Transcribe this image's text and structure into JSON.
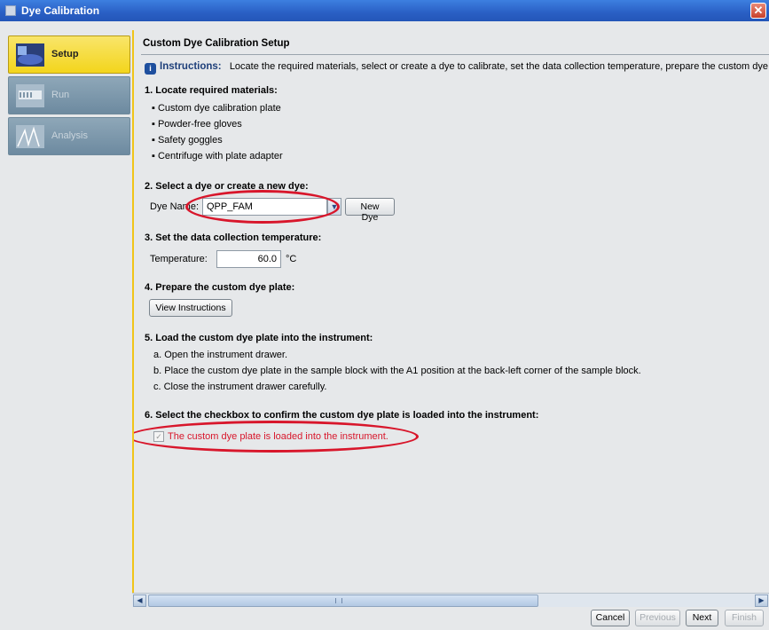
{
  "window": {
    "title": "Dye Calibration"
  },
  "nav": {
    "items": [
      {
        "label": "Setup",
        "icon": "setup-icon",
        "state": "active"
      },
      {
        "label": "Run",
        "icon": "run-icon",
        "state": "disabled"
      },
      {
        "label": "Analysis",
        "icon": "analysis-icon",
        "state": "disabled"
      }
    ]
  },
  "content": {
    "header": "Custom Dye Calibration Setup",
    "instructions_label": "Instructions:",
    "instructions_text": "Locate the required materials, select or create a dye to calibrate, set the data collection temperature, prepare the custom dye",
    "step1": {
      "title": "1. Locate required materials:",
      "items": [
        "Custom dye calibration plate",
        "Powder-free gloves",
        "Safety goggles",
        "Centrifuge with plate adapter"
      ]
    },
    "step2": {
      "title": "2. Select a dye or create a new dye:",
      "dye_label": "Dye Name:",
      "dye_value": "QPP_FAM",
      "new_dye_button": "New Dye"
    },
    "step3": {
      "title": "3. Set the data collection temperature:",
      "temp_label": "Temperature:",
      "temp_value": "60.0",
      "temp_unit": "°C"
    },
    "step4": {
      "title": "4. Prepare the custom dye plate:",
      "view_button": "View Instructions"
    },
    "step5": {
      "title": "5. Load the custom dye plate into the instrument:",
      "items": [
        "a. Open the instrument drawer.",
        "b. Place the custom dye plate in the sample block with the A1 position at the back-left corner of the sample block.",
        "c. Close the instrument drawer carefully."
      ]
    },
    "step6": {
      "title": "6. Select the checkbox to confirm the custom dye plate is loaded into the instrument:",
      "checkbox_label": "The custom dye plate is loaded into the instrument.",
      "checked": true
    }
  },
  "footer": {
    "cancel": "Cancel",
    "previous": "Previous",
    "next": "Next",
    "finish": "Finish"
  },
  "colors": {
    "accent": "#f3d51c",
    "highlight": "#d8162b",
    "title_bar": "#2a5fc4"
  }
}
